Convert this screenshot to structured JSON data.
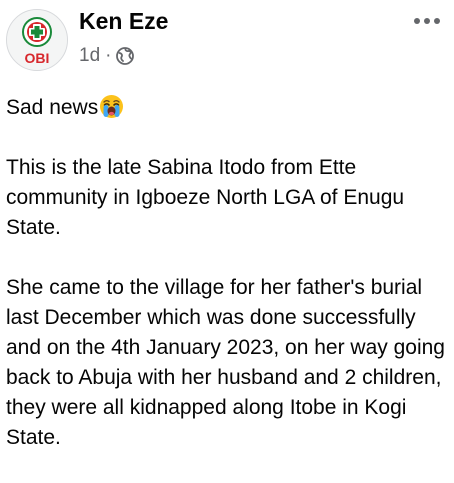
{
  "post": {
    "author": "Ken Eze",
    "avatar_label": "OBI",
    "time": "1d",
    "separator": "·",
    "privacy_icon": "globe-icon",
    "more_icon": "more-dots-icon",
    "paragraphs": [
      "Sad news",
      "This is the late Sabina Itodo from Ette community in Igboeze North LGA of Enugu State.",
      "She came to the village for her father's burial last December which was done successfully and on the 4th January 2023, on her way going back to Abuja with her husband and 2 children, they were all kidnapped along Itobe in Kogi State."
    ],
    "emoji": "crying-face-emoji-icon"
  },
  "colors": {
    "text": "#050505",
    "secondary_text": "#65676b",
    "avatar_red": "#d7272c",
    "avatar_green": "#1a8a3a"
  }
}
